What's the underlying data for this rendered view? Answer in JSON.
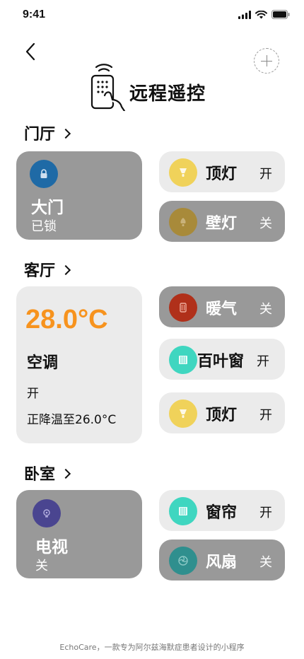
{
  "status": {
    "time": "9:41"
  },
  "header": {
    "title": "远程遥控"
  },
  "rooms": [
    {
      "name": "门厅",
      "main": {
        "name": "大门",
        "state": "已锁",
        "icon": "lock-icon",
        "icon_color": "#1f6aa6"
      },
      "devices": [
        {
          "name": "顶灯",
          "state": "开",
          "icon": "ceiling-light-icon",
          "icon_color": "#f0d25a",
          "active": true
        },
        {
          "name": "壁灯",
          "state": "关",
          "icon": "wall-light-icon",
          "icon_color": "#a88a3a",
          "active": false
        }
      ]
    },
    {
      "name": "客厅",
      "main": {
        "temperature": "28.0°C",
        "name": "空调",
        "power": "开",
        "mode": "正降温至26.0°C",
        "accent": "#f7931e"
      },
      "devices": [
        {
          "name": "暖气",
          "state": "关",
          "icon": "heater-icon",
          "icon_color": "#b0301a",
          "active": false
        },
        {
          "name": "百叶窗",
          "state": "开",
          "icon": "blinds-icon",
          "icon_color": "#3fd6c0",
          "active": true
        },
        {
          "name": "顶灯",
          "state": "开",
          "icon": "ceiling-light-icon",
          "icon_color": "#f0d25a",
          "active": true
        }
      ]
    },
    {
      "name": "卧室",
      "main": {
        "name": "电视",
        "state": "关",
        "icon": "tv-icon",
        "icon_color": "#4a4590"
      },
      "devices": [
        {
          "name": "窗帘",
          "state": "开",
          "icon": "curtain-icon",
          "icon_color": "#3fd6c0",
          "active": true
        },
        {
          "name": "风扇",
          "state": "关",
          "icon": "fan-icon",
          "icon_color": "#2f8f8e",
          "active": false
        }
      ]
    }
  ],
  "footer": {
    "text": "EchoCare，一款专为阿尔兹海默症患者设计的小程序"
  }
}
